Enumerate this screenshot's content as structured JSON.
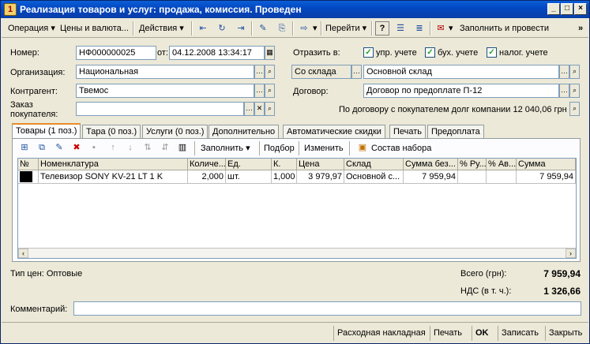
{
  "window": {
    "title": "Реализация товаров и услуг: продажа, комиссия. Проведен",
    "minimize": "_",
    "maximize": "□",
    "close": "×"
  },
  "toolbar": {
    "operation": "Операция",
    "prices": "Цены и валюта...",
    "actions": "Действия",
    "goto": "Перейти",
    "help": "?",
    "fill_and_post": "Заполнить и провести",
    "more": "»"
  },
  "form": {
    "number_label": "Номер:",
    "number_value": "НФ000000025",
    "date_label": "от:",
    "date_value": "04.12.2008 13:34:17",
    "org_label": "Организация:",
    "org_value": "Национальная",
    "contractor_label": "Контрагент:",
    "contractor_value": "Твемос",
    "order_label_1": "Заказ",
    "order_label_2": "покупателя:",
    "order_value": "",
    "reflect_label": "Отразить в:",
    "check_upr": "упр. учете",
    "check_buh": "бух. учете",
    "check_nalog": "налог. учете",
    "from_warehouse_value": "Со склада",
    "warehouse_value": "Основной склад",
    "contract_label": "Договор:",
    "contract_value": "Договор по предоплате П-12",
    "debt_text": "По договору с покупателем долг компании 12 040,06 грн"
  },
  "tabs": [
    {
      "label": "Товары (1 поз.)"
    },
    {
      "label": "Тара (0 поз.)"
    },
    {
      "label": "Услуги (0 поз.)"
    },
    {
      "label": "Дополнительно"
    },
    {
      "label": "Автоматические скидки"
    },
    {
      "label": "Печать"
    },
    {
      "label": "Предоплата"
    }
  ],
  "grid_toolbar": {
    "fill": "Заполнить",
    "selection": "Подбор",
    "change": "Изменить",
    "set_composition": "Состав набора"
  },
  "grid": {
    "headers": [
      "№",
      "Номенклатура",
      "Количе...",
      "Ед.",
      "К.",
      "Цена",
      "Склад",
      "Сумма без...",
      "% Ру...",
      "% Ав...",
      "Сумма"
    ],
    "rows": [
      {
        "num": "",
        "item": "Телевизор SONY KV-21 LT 1 K",
        "qty": "2,000",
        "unit": "шт.",
        "coef": "1,000",
        "price": "3 979,97",
        "warehouse": "Основной с...",
        "sum_without": "7 959,94",
        "pct_manual": "",
        "pct_auto": "",
        "sum": "7 959,94"
      }
    ]
  },
  "totals": {
    "price_type": "Тип цен: Оптовые",
    "total_label": "Всего (грн):",
    "total_value": "7 959,94",
    "vat_label": "НДС (в т. ч.):",
    "vat_value": "1 326,66"
  },
  "comment": {
    "label": "Комментарий:",
    "value": ""
  },
  "bottom": {
    "invoice": "Расходная накладная",
    "print": "Печать",
    "ok": "OK",
    "save": "Записать",
    "close": "Закрыть"
  }
}
